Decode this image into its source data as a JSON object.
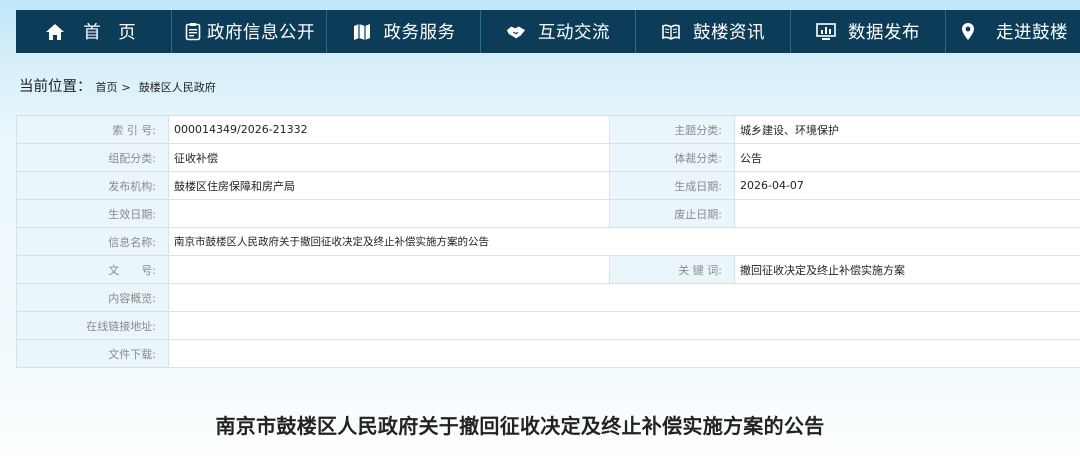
{
  "nav": {
    "items": [
      {
        "label": "首  页",
        "icon": "home-icon"
      },
      {
        "label": "政府信息公开",
        "icon": "clipboard-icon"
      },
      {
        "label": "政务服务",
        "icon": "map-icon"
      },
      {
        "label": "互动交流",
        "icon": "handshake-icon"
      },
      {
        "label": "鼓楼资讯",
        "icon": "book-icon"
      },
      {
        "label": "数据发布",
        "icon": "monitor-chart-icon"
      },
      {
        "label": "走进鼓楼",
        "icon": "location-pin-icon"
      }
    ],
    "colors": {
      "background": "#0c3c57",
      "text": "#ffffff",
      "divider": "#2a6a8a"
    }
  },
  "breadcrumb": {
    "label": "当前位置：",
    "items": [
      "首页",
      "鼓楼区人民政府"
    ],
    "separator": ">"
  },
  "meta": {
    "rows": [
      {
        "k1": "索 引 号:",
        "v1": "000014349/2026-21332",
        "k2": "主题分类:",
        "v2": "城乡建设、环境保护"
      },
      {
        "k1": "组配分类:",
        "v1": "征收补偿",
        "k2": "体裁分类:",
        "v2": "公告"
      },
      {
        "k1": "发布机构:",
        "v1": "鼓楼区住房保障和房产局",
        "k2": "生成日期:",
        "v2": "2026-04-07"
      },
      {
        "k1": "生效日期:",
        "v1": "",
        "k2": "废止日期:",
        "v2": ""
      },
      {
        "k1": "信息名称:",
        "v1": "南京市鼓楼区人民政府关于撤回征收决定及终止补偿实施方案的公告"
      },
      {
        "k1": "文　　号:",
        "v1": "",
        "k2": "关 键 词:",
        "v2": "撤回征收决定及终止补偿实施方案"
      },
      {
        "k1": "内容概览:",
        "v1": ""
      },
      {
        "k1": "在线链接地址:",
        "v1": ""
      },
      {
        "k1": "文件下载:",
        "v1": ""
      }
    ],
    "colors": {
      "key_bg": "#eaf6fc",
      "key_text": "#8a8a8a",
      "border": "#d4e3ea"
    }
  },
  "article": {
    "title": "南京市鼓楼区人民政府关于撤回征收决定及终止补偿实施方案的公告"
  }
}
